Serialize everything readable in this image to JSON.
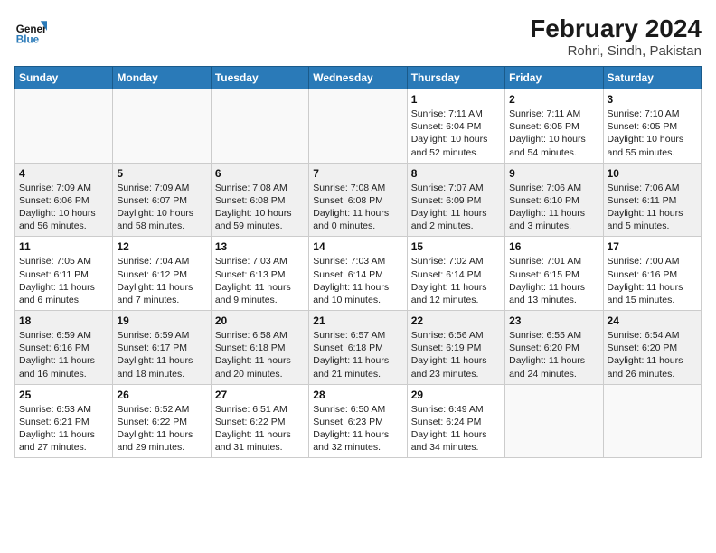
{
  "header": {
    "logo_text_general": "General",
    "logo_text_blue": "Blue",
    "title": "February 2024",
    "subtitle": "Rohri, Sindh, Pakistan"
  },
  "days_of_week": [
    "Sunday",
    "Monday",
    "Tuesday",
    "Wednesday",
    "Thursday",
    "Friday",
    "Saturday"
  ],
  "weeks": [
    {
      "shaded": false,
      "days": [
        {
          "num": "",
          "info": ""
        },
        {
          "num": "",
          "info": ""
        },
        {
          "num": "",
          "info": ""
        },
        {
          "num": "",
          "info": ""
        },
        {
          "num": "1",
          "info": "Sunrise: 7:11 AM\nSunset: 6:04 PM\nDaylight: 10 hours\nand 52 minutes."
        },
        {
          "num": "2",
          "info": "Sunrise: 7:11 AM\nSunset: 6:05 PM\nDaylight: 10 hours\nand 54 minutes."
        },
        {
          "num": "3",
          "info": "Sunrise: 7:10 AM\nSunset: 6:05 PM\nDaylight: 10 hours\nand 55 minutes."
        }
      ]
    },
    {
      "shaded": true,
      "days": [
        {
          "num": "4",
          "info": "Sunrise: 7:09 AM\nSunset: 6:06 PM\nDaylight: 10 hours\nand 56 minutes."
        },
        {
          "num": "5",
          "info": "Sunrise: 7:09 AM\nSunset: 6:07 PM\nDaylight: 10 hours\nand 58 minutes."
        },
        {
          "num": "6",
          "info": "Sunrise: 7:08 AM\nSunset: 6:08 PM\nDaylight: 10 hours\nand 59 minutes."
        },
        {
          "num": "7",
          "info": "Sunrise: 7:08 AM\nSunset: 6:08 PM\nDaylight: 11 hours\nand 0 minutes."
        },
        {
          "num": "8",
          "info": "Sunrise: 7:07 AM\nSunset: 6:09 PM\nDaylight: 11 hours\nand 2 minutes."
        },
        {
          "num": "9",
          "info": "Sunrise: 7:06 AM\nSunset: 6:10 PM\nDaylight: 11 hours\nand 3 minutes."
        },
        {
          "num": "10",
          "info": "Sunrise: 7:06 AM\nSunset: 6:11 PM\nDaylight: 11 hours\nand 5 minutes."
        }
      ]
    },
    {
      "shaded": false,
      "days": [
        {
          "num": "11",
          "info": "Sunrise: 7:05 AM\nSunset: 6:11 PM\nDaylight: 11 hours\nand 6 minutes."
        },
        {
          "num": "12",
          "info": "Sunrise: 7:04 AM\nSunset: 6:12 PM\nDaylight: 11 hours\nand 7 minutes."
        },
        {
          "num": "13",
          "info": "Sunrise: 7:03 AM\nSunset: 6:13 PM\nDaylight: 11 hours\nand 9 minutes."
        },
        {
          "num": "14",
          "info": "Sunrise: 7:03 AM\nSunset: 6:14 PM\nDaylight: 11 hours\nand 10 minutes."
        },
        {
          "num": "15",
          "info": "Sunrise: 7:02 AM\nSunset: 6:14 PM\nDaylight: 11 hours\nand 12 minutes."
        },
        {
          "num": "16",
          "info": "Sunrise: 7:01 AM\nSunset: 6:15 PM\nDaylight: 11 hours\nand 13 minutes."
        },
        {
          "num": "17",
          "info": "Sunrise: 7:00 AM\nSunset: 6:16 PM\nDaylight: 11 hours\nand 15 minutes."
        }
      ]
    },
    {
      "shaded": true,
      "days": [
        {
          "num": "18",
          "info": "Sunrise: 6:59 AM\nSunset: 6:16 PM\nDaylight: 11 hours\nand 16 minutes."
        },
        {
          "num": "19",
          "info": "Sunrise: 6:59 AM\nSunset: 6:17 PM\nDaylight: 11 hours\nand 18 minutes."
        },
        {
          "num": "20",
          "info": "Sunrise: 6:58 AM\nSunset: 6:18 PM\nDaylight: 11 hours\nand 20 minutes."
        },
        {
          "num": "21",
          "info": "Sunrise: 6:57 AM\nSunset: 6:18 PM\nDaylight: 11 hours\nand 21 minutes."
        },
        {
          "num": "22",
          "info": "Sunrise: 6:56 AM\nSunset: 6:19 PM\nDaylight: 11 hours\nand 23 minutes."
        },
        {
          "num": "23",
          "info": "Sunrise: 6:55 AM\nSunset: 6:20 PM\nDaylight: 11 hours\nand 24 minutes."
        },
        {
          "num": "24",
          "info": "Sunrise: 6:54 AM\nSunset: 6:20 PM\nDaylight: 11 hours\nand 26 minutes."
        }
      ]
    },
    {
      "shaded": false,
      "days": [
        {
          "num": "25",
          "info": "Sunrise: 6:53 AM\nSunset: 6:21 PM\nDaylight: 11 hours\nand 27 minutes."
        },
        {
          "num": "26",
          "info": "Sunrise: 6:52 AM\nSunset: 6:22 PM\nDaylight: 11 hours\nand 29 minutes."
        },
        {
          "num": "27",
          "info": "Sunrise: 6:51 AM\nSunset: 6:22 PM\nDaylight: 11 hours\nand 31 minutes."
        },
        {
          "num": "28",
          "info": "Sunrise: 6:50 AM\nSunset: 6:23 PM\nDaylight: 11 hours\nand 32 minutes."
        },
        {
          "num": "29",
          "info": "Sunrise: 6:49 AM\nSunset: 6:24 PM\nDaylight: 11 hours\nand 34 minutes."
        },
        {
          "num": "",
          "info": ""
        },
        {
          "num": "",
          "info": ""
        }
      ]
    }
  ]
}
